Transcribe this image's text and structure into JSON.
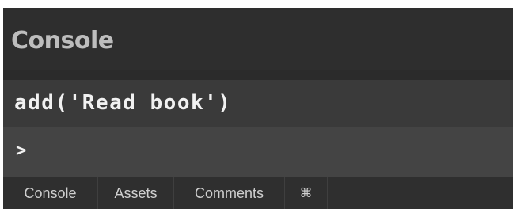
{
  "panel": {
    "title": "Console"
  },
  "console": {
    "output_line": "add('Read book')",
    "prompt_symbol": ">"
  },
  "tabs": [
    {
      "label": "Console"
    },
    {
      "label": "Assets"
    },
    {
      "label": "Comments"
    },
    {
      "label": "⌘"
    }
  ],
  "colors": {
    "background": "#2b2b2b",
    "output_line_bg": "#3a3a3a",
    "input_line_bg": "#444444",
    "text": "#f1f1f1"
  }
}
